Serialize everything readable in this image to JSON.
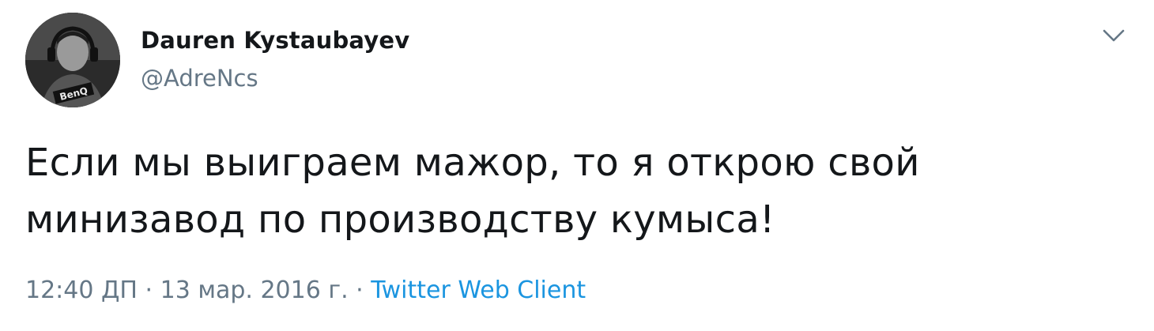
{
  "author": {
    "name": "Dauren Kystaubayev",
    "handle": "@AdreNcs",
    "avatar_badge": "BenQ"
  },
  "tweet": {
    "text": "Если мы выиграем мажор, то я открою свой минизавод по производству кумыса!"
  },
  "meta": {
    "time": "12:40 ДП",
    "separator": " · ",
    "date": "13 мар. 2016 г.",
    "source": "Twitter Web Client"
  },
  "icons": {
    "menu": "chevron-down-icon"
  },
  "colors": {
    "text": "#14171a",
    "secondary": "#657786",
    "link": "#1b95e0",
    "background": "#ffffff"
  }
}
